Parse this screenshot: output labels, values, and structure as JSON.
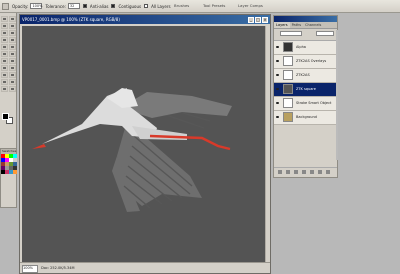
{
  "options_bar": {
    "opacity_label": "Opacity:",
    "opacity_value": "100%",
    "tolerance_label": "Tolerance:",
    "tolerance_value": "32",
    "antialias_label": "Anti-alias",
    "contiguous_label": "Contiguous",
    "all_layers_label": "All Layers",
    "right_tabs": [
      "Brushes",
      "Tool Presets",
      "Layer Comps"
    ]
  },
  "document": {
    "title": "VP0017_0001.bmp @ 100% (ZTK square, RGB/8)",
    "zoom": "100%",
    "status": "Doc: 252.0K/5.34M",
    "canvas_color": "#545454",
    "bird_body_color": "#d9d9d9",
    "bird_wing_color": "#6e6e6e",
    "beak_color": "#d83a2a"
  },
  "layers_panel": {
    "tabs": [
      "Layers",
      "Paths",
      "Channels"
    ],
    "active_tab": "Layers",
    "layers": [
      {
        "name": "Alpha",
        "selected": false
      },
      {
        "name": "ZTK2AS Overlays",
        "selected": false
      },
      {
        "name": "ZTK2AS",
        "selected": false
      },
      {
        "name": "ZTK square",
        "selected": true
      },
      {
        "name": "Stroke Smart Object",
        "selected": false
      },
      {
        "name": "Background",
        "selected": false
      }
    ]
  },
  "swatches": {
    "title": "Swatches",
    "colors": [
      "#ff0000",
      "#ffff00",
      "#00ff00",
      "#00ffff",
      "#0000ff",
      "#ff00ff",
      "#ffffff",
      "#cccccc",
      "#993333",
      "#cc9966",
      "#669933",
      "#336699",
      "#660066",
      "#999999",
      "#666666",
      "#333333",
      "#000000",
      "#cc3366",
      "#3399cc",
      "#ff9933"
    ]
  }
}
